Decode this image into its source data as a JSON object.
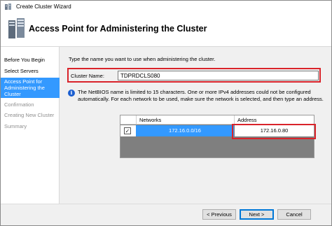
{
  "window": {
    "title": "Create Cluster Wizard",
    "heading": "Access Point for Administering the Cluster"
  },
  "steps": [
    {
      "label": "Before You Begin",
      "state": "normal"
    },
    {
      "label": "Select Servers",
      "state": "normal"
    },
    {
      "label": "Access Point for Administering the Cluster",
      "state": "active"
    },
    {
      "label": "Confirmation",
      "state": "disabled"
    },
    {
      "label": "Creating New Cluster",
      "state": "disabled"
    },
    {
      "label": "Summary",
      "state": "disabled"
    }
  ],
  "main": {
    "intro": "Type the name you want to use when administering the cluster.",
    "cluster_name_label": "Cluster Name:",
    "cluster_name_value": "TDPRDCLS080",
    "info_text": "The NetBIOS name is limited to 15 characters.  One or more IPv4 addresses could not be configured automatically. For each network to be used, make sure the network is selected, and then type an address."
  },
  "grid": {
    "columns": [
      "Networks",
      "Address"
    ],
    "rows": [
      {
        "checked": true,
        "network": "172.16.0.0/16",
        "address": "172.16.0.80"
      }
    ]
  },
  "buttons": {
    "previous": "< Previous",
    "next": "Next >",
    "cancel": "Cancel"
  },
  "colors": {
    "selection": "#3399ff",
    "highlight_border": "#d9232a",
    "info_icon": "#1c5fd0"
  }
}
